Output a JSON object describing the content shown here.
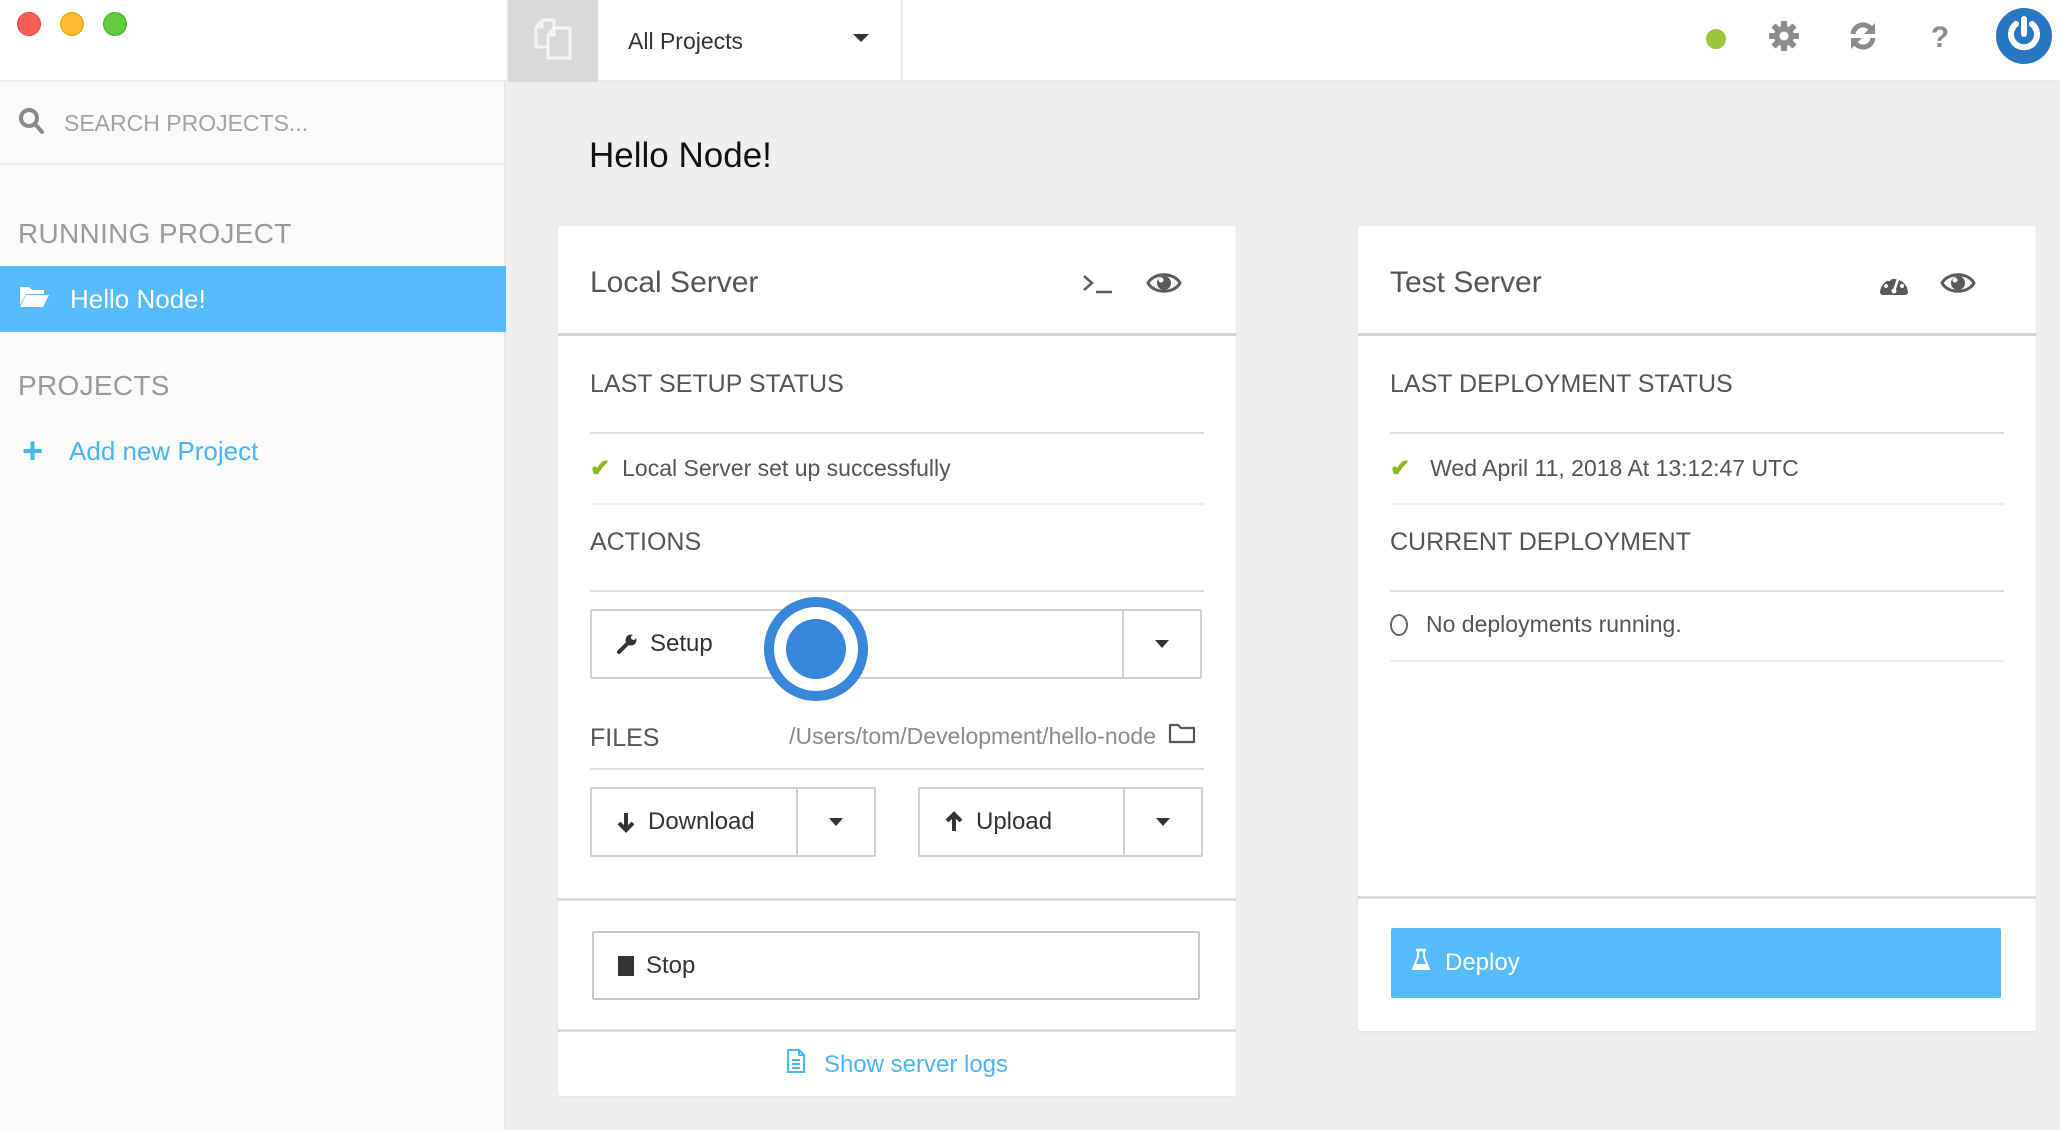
{
  "window": {
    "traffic_lights": [
      "close",
      "minimize",
      "maximize"
    ]
  },
  "sidebar": {
    "search": {
      "placeholder": "SEARCH PROJECTS...",
      "value": ""
    },
    "running_section_label": "RUNNING PROJECT",
    "running_project": {
      "label": "Hello Node!",
      "icon": "folder-open-icon",
      "active": true
    },
    "projects_section_label": "PROJECTS",
    "add_project_label": "Add new Project"
  },
  "topbar": {
    "project_selector": {
      "selected": "All Projects"
    },
    "status_color": "#9dc33b",
    "icons": [
      "settings-icon",
      "refresh-icon",
      "help-icon",
      "power-icon"
    ]
  },
  "main": {
    "title": "Hello Node!",
    "local_server": {
      "title": "Local Server",
      "header_icons": [
        "terminal-icon",
        "eye-icon"
      ],
      "last_setup_label": "LAST SETUP STATUS",
      "last_setup_status": "Local Server set up successfully",
      "actions_label": "ACTIONS",
      "setup_button": "Setup",
      "files_label": "FILES",
      "files_path": "/Users/tom/Development/hello-node",
      "download_button": "Download",
      "upload_button": "Upload",
      "stop_button": "Stop",
      "logs_link": "Show server logs"
    },
    "test_server": {
      "title": "Test Server",
      "header_icons": [
        "dashboard-icon",
        "eye-icon"
      ],
      "last_deployment_label": "LAST DEPLOYMENT STATUS",
      "last_deployment_status": "Wed April 11, 2018 At 13:12:47 UTC",
      "current_deployment_label": "CURRENT DEPLOYMENT",
      "current_deployment_status": "No deployments running.",
      "deploy_button": "Deploy"
    }
  },
  "colors": {
    "accent": "#55bbfd",
    "link": "#4cb6f6",
    "success": "#88b822",
    "power_button": "#2877c3"
  }
}
